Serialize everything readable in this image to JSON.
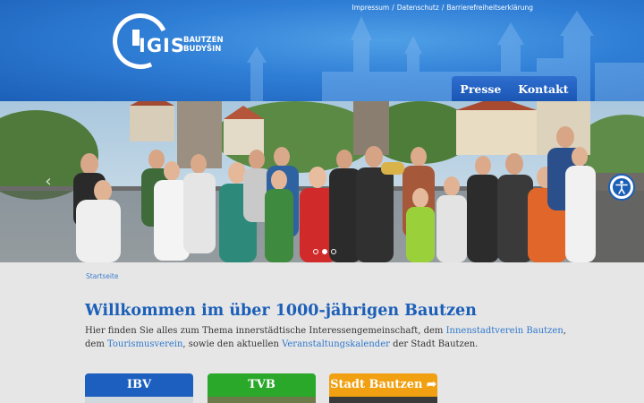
{
  "toplinks": [
    "Impressum",
    "Datenschutz",
    "Barrierefreiheitserklärung"
  ],
  "logo": {
    "brand": "IGIS",
    "city_line1": "BAUTZEN",
    "city_line2": "BUDYŠIN"
  },
  "nav": {
    "items": [
      "Presse",
      "Kontakt"
    ]
  },
  "slider": {
    "slide_count": 3,
    "active_index": 1
  },
  "breadcrumb": "Startseite",
  "headline": "Willkommen im über 1000-jährigen Bautzen",
  "intro": {
    "part1": "Hier finden Sie alles zum Thema innerstädtische Interessengemeinschaft, dem ",
    "link1": "Innenstadtverein Bautzen",
    "part2": ", dem ",
    "link2": "Tourismusverein",
    "part3": ", sowie den aktuellen ",
    "link3": "Veranstaltungskalender",
    "part4": " der Stadt Bautzen."
  },
  "tiles": [
    {
      "label": "IBV",
      "color": "#1d5fbf"
    },
    {
      "label": "TVB",
      "color": "#2aa82a"
    },
    {
      "label": "Stadt Bautzen",
      "color": "#f0a010"
    }
  ],
  "icons": [
    "accessibility-icon",
    "arrow-left-icon",
    "share-arrow-icon"
  ]
}
